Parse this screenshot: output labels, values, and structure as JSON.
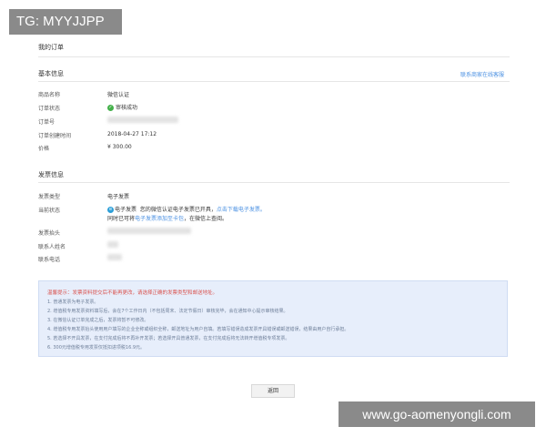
{
  "watermarks": {
    "top": "TG: MYYJJPP",
    "bottom": "www.go-aomenyongli.com"
  },
  "page": {
    "title": "我的订单"
  },
  "basic": {
    "title": "基本信息",
    "link": "联系商家在线客服",
    "rows": [
      {
        "label": "商品名称",
        "value": "微信认证"
      },
      {
        "label": "订单状态",
        "value": "审核成功",
        "icon": "check-circle-icon"
      },
      {
        "label": "订单号",
        "value": ""
      },
      {
        "label": "订单创建时间",
        "value": "2018-04-27 17:12"
      },
      {
        "label": "价格",
        "value": "¥ 300.00"
      }
    ]
  },
  "invoice": {
    "title": "发票信息",
    "type_label": "发票类型",
    "type_value": "电子发票",
    "status_label": "当前状态",
    "status_icon_char": "e",
    "status_line1_a": "电子发票",
    "status_line1_b": "您的微信认证电子发票已开具，",
    "status_line1_link": "点击下载电子发票。",
    "status_line2_a": "同时已可将",
    "status_line2_link": "电子发票添加至卡包",
    "status_line2_b": "，在微信上查阅。",
    "header_label": "发票抬头",
    "contact_label": "联系人姓名",
    "phone_label": "联系电话"
  },
  "notice": {
    "heading": "温馨提示：发票资料提交后不能再更改，请选择正确的发票类型和邮送地址。",
    "items": [
      "1. 普通发票为电子发票。",
      "2. 增值税专用发票资料填写后，会在7个工作日内（不包括周末、法定节假日）审核完毕，会在通知中心提示审核结果。",
      "3. 在微信认证订单完成之后，发票将暂不可修改。",
      "4. 增值税专用发票抬头使用用户填写的企业全称或组织全称，邮送地址为用户自填。若填写错误造成发票开具错误或邮送错误，结果由用户自行承担。",
      "5. 若选择不开具发票，在支付完成后将不再补开发票；若选择开具普通发票，在支付完成后将无法转开增值税专项发票。",
      "6. 300元增值税专用发票仅抵扣进项税16.9元。"
    ]
  },
  "button": {
    "back": "返回"
  }
}
